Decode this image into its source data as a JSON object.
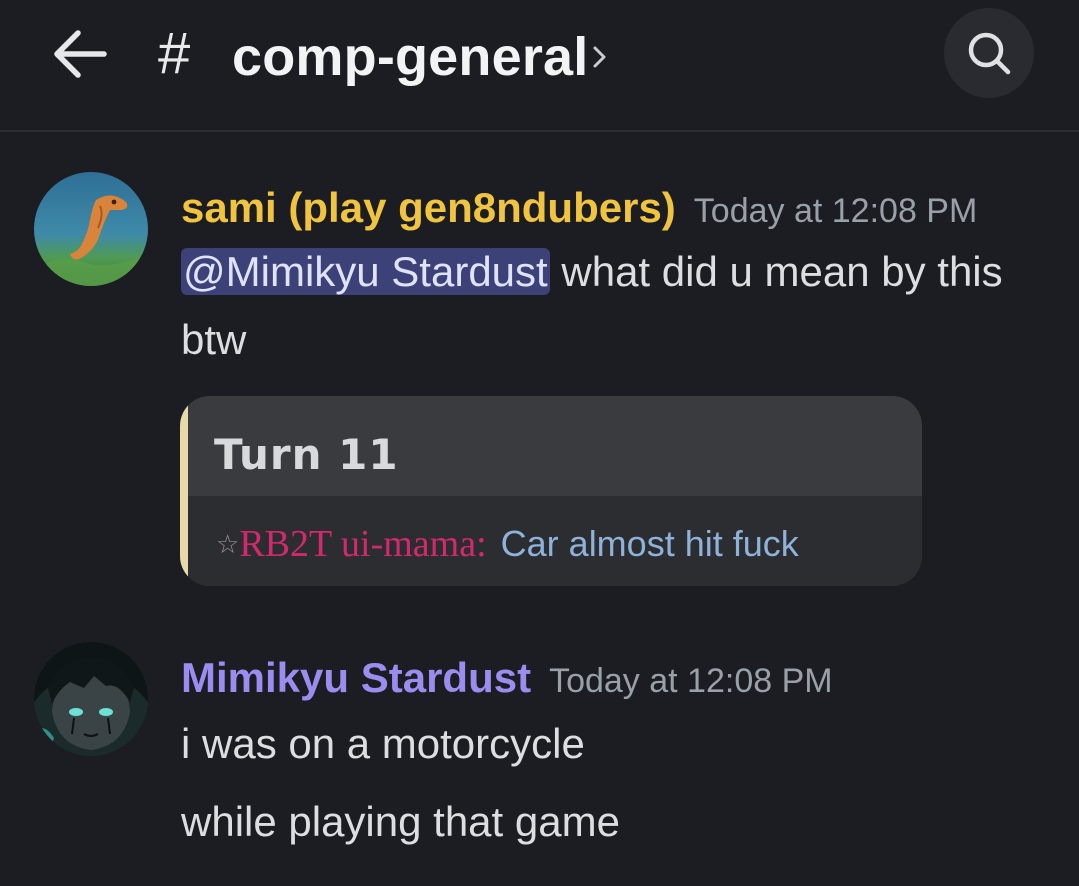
{
  "header": {
    "back_icon": "arrow-left-icon",
    "hash_symbol": "#",
    "channel_name": "comp-general",
    "chevron_icon": "chevron-right-icon",
    "search_icon": "search-icon"
  },
  "messages": [
    {
      "username": "sami (play gen8ndubers)",
      "username_color": "#f0c43f",
      "timestamp": "Today at 12:08 PM",
      "mention": "@Mimikyu Stardust",
      "text_after_mention": " what did u mean by this btw",
      "embed": {
        "title": "Turn 11",
        "star": "☆",
        "user": "RB2T ui-mama:",
        "line": "Car almost hit fuck"
      }
    },
    {
      "username": "Mimikyu Stardust",
      "username_color": "#9b8cf0",
      "timestamp": "Today at 12:08 PM",
      "lines": [
        "i was on a motorcycle",
        "while playing that game"
      ]
    }
  ]
}
